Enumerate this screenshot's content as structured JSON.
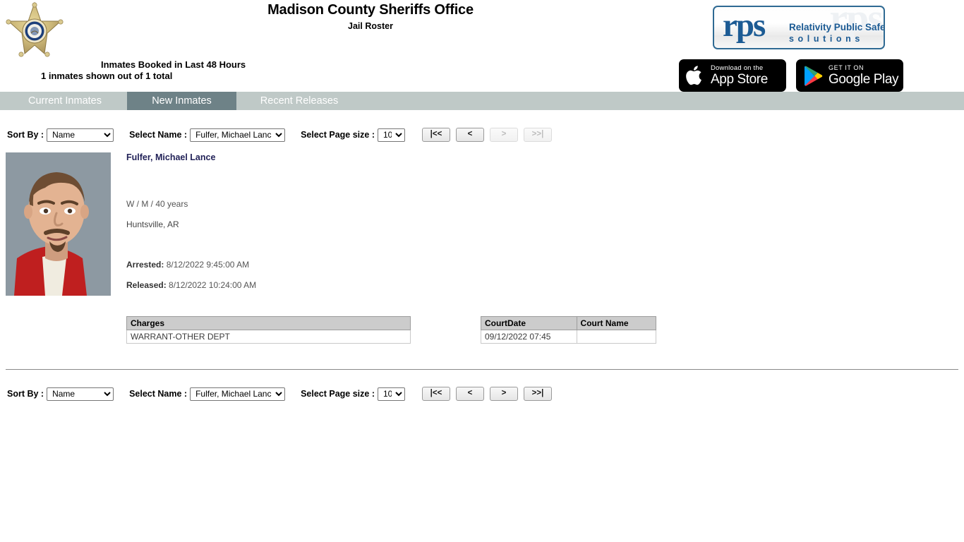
{
  "header": {
    "title": "Madison County Sheriffs Office",
    "subtitle": "Jail Roster",
    "booked_line": "Inmates Booked in Last 48 Hours",
    "shown_line": "1 inmates shown out of 1 total",
    "badge_icon": "sheriff-star-badge-icon"
  },
  "logo": {
    "rps_mark": "rps",
    "watermark": "rps",
    "tagline": "Relativity Public Safety",
    "tagline2": "solutions"
  },
  "store_badges": {
    "apple": {
      "small": "Download on the",
      "big": "App Store",
      "icon": "apple-icon"
    },
    "google": {
      "small": "GET IT ON",
      "big": "Google Play",
      "icon": "google-play-icon"
    }
  },
  "tabs": [
    {
      "label": "Current Inmates",
      "active": false
    },
    {
      "label": "New Inmates",
      "active": true
    },
    {
      "label": "Recent Releases",
      "active": false
    }
  ],
  "controls": {
    "sort_label": "Sort By :",
    "sort_value": "Name",
    "sort_options": [
      "Name"
    ],
    "name_label": "Select Name :",
    "name_value": "Fulfer, Michael Lance",
    "name_options": [
      "Fulfer, Michael Lance"
    ],
    "pagesize_label": "Select Page size :",
    "pagesize_value": "10",
    "pagesize_options": [
      "10"
    ],
    "pager_top": [
      {
        "label": "|<<",
        "name": "first-page-button",
        "disabled": false
      },
      {
        "label": "<",
        "name": "prev-page-button",
        "disabled": false
      },
      {
        "label": ">",
        "name": "next-page-button",
        "disabled": true
      },
      {
        "label": ">>|",
        "name": "last-page-button",
        "disabled": true
      }
    ],
    "pager_bottom": [
      {
        "label": "|<<",
        "name": "first-page-button",
        "disabled": false
      },
      {
        "label": "<",
        "name": "prev-page-button",
        "disabled": false
      },
      {
        "label": ">",
        "name": "next-page-button",
        "disabled": false
      },
      {
        "label": ">>|",
        "name": "last-page-button",
        "disabled": false
      }
    ]
  },
  "inmate": {
    "name": "Fulfer, Michael Lance",
    "demographics": "W / M / 40 years",
    "city_state": "Huntsville, AR",
    "arrested_label": "Arrested:",
    "arrested_value": "8/12/2022 9:45:00 AM",
    "released_label": "Released:",
    "released_value": "8/12/2022 10:24:00 AM",
    "mugshot_alt": "inmate-mugshot"
  },
  "charges_table": {
    "header": "Charges",
    "rows": [
      "WARRANT-OTHER DEPT"
    ]
  },
  "court_table": {
    "headers": [
      "CourtDate",
      "Court Name"
    ],
    "rows": [
      [
        "09/12/2022 07:45",
        ""
      ]
    ]
  },
  "colors": {
    "tab_bar": "#bfc9c7",
    "tab_active": "#6e8287",
    "brand_blue": "#1c5b94",
    "name_link": "#222258",
    "table_header": "#cccccc"
  }
}
